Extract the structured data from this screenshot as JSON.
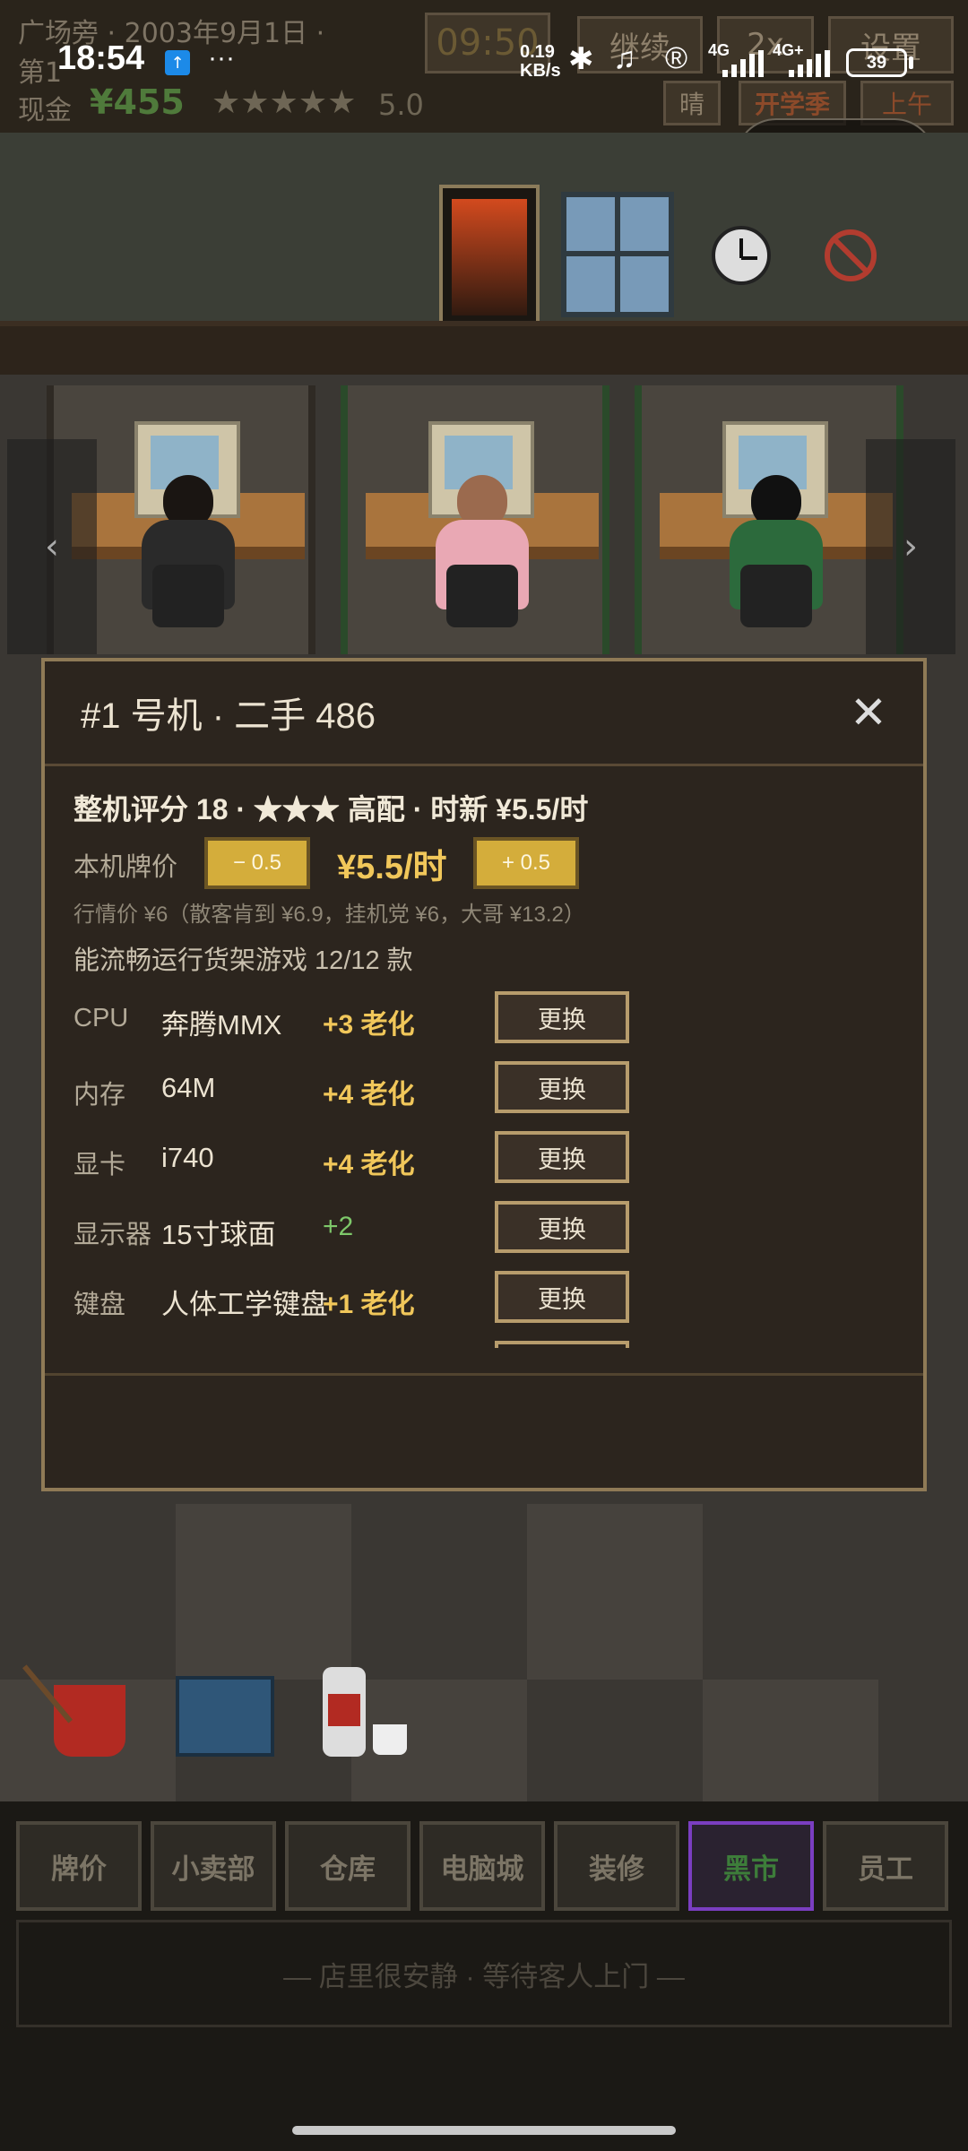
{
  "hud": {
    "location_date": "广场旁 · 2003年9月1日 ·",
    "day_prefix": "第1",
    "cash_label": "现金",
    "cash_value": "¥455",
    "stars": "★★★★★",
    "rating": "5.0",
    "clock": "09:50",
    "btn_continue": "继续",
    "btn_speed": "2x",
    "btn_settings": "设置",
    "weather": "晴",
    "season": "开学季",
    "period": "上午"
  },
  "status_bar": {
    "time": "18:54",
    "net_speed_top": "0.19",
    "net_speed_bottom": "KB/s",
    "net_1": "4G",
    "net_2": "4G+",
    "battery": "39"
  },
  "modal": {
    "title": "#1 号机 · 二手 486",
    "summary": "整机评分 18 · ★★★ 高配 · 时新 ¥5.5/时",
    "price_label": "本机牌价",
    "minus_label": "− 0.5",
    "price_value": "¥5.5/时",
    "plus_label": "+ 0.5",
    "market_note": "行情价 ¥6（散客肯到 ¥6.9，挂机党 ¥6，大哥 ¥13.2）",
    "run_note": "能流畅运行货架游戏 12/12 款",
    "replace_label": "更换",
    "parts": [
      {
        "name": "CPU",
        "model": "奔腾MMX",
        "stat": "+3 老化"
      },
      {
        "name": "内存",
        "model": "64M",
        "stat": "+4 老化"
      },
      {
        "name": "显卡",
        "model": "i740",
        "stat": "+4 老化"
      },
      {
        "name": "显示器",
        "model": "15寸球面",
        "stat": "+2"
      },
      {
        "name": "键盘",
        "model": "人体工学键盘",
        "stat": "+1 老化"
      }
    ]
  },
  "nav": {
    "items": [
      "牌价",
      "小卖部",
      "仓库",
      "电脑城",
      "装修",
      "黑市",
      "员工"
    ],
    "active": "黑市",
    "message": "— 店里很安静 · 等待客人上门 —"
  },
  "colors": {
    "accent_gold": "#f1c75a",
    "good_green": "#7ec86a",
    "active_purple": "#7a3ec0"
  }
}
